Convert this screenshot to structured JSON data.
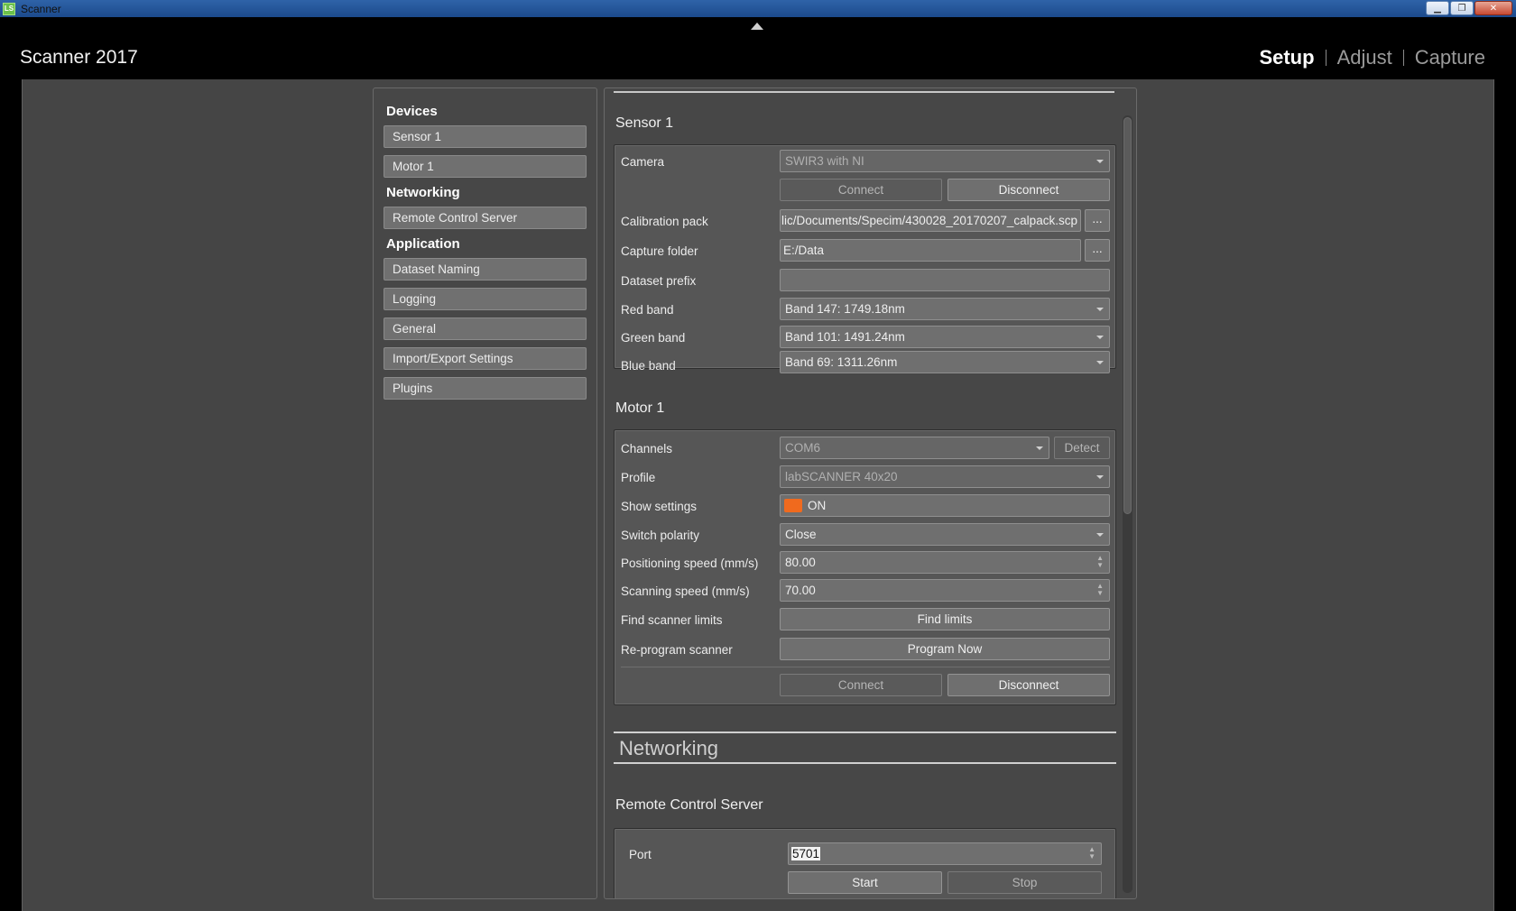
{
  "window": {
    "icon_text": "LS",
    "title": "Scanner",
    "minimize": "▁",
    "maximize": "❐",
    "close": "✕"
  },
  "app": {
    "title": "Scanner 2017"
  },
  "nav": {
    "setup": "Setup",
    "adjust": "Adjust",
    "capture": "Capture"
  },
  "menu": {
    "devices": "Devices",
    "sensor1": "Sensor 1",
    "motor1": "Motor 1",
    "networking": "Networking",
    "remote": "Remote Control Server",
    "application": "Application",
    "dataset_naming": "Dataset Naming",
    "logging": "Logging",
    "general": "General",
    "import_export": "Import/Export Settings",
    "plugins": "Plugins"
  },
  "sensor": {
    "title": "Sensor 1",
    "camera_label": "Camera",
    "camera_value": "SWIR3 with NI",
    "connect": "Connect",
    "disconnect": "Disconnect",
    "calib_label": "Calibration pack",
    "calib_value": "lic/Documents/Specim/430028_20170207_calpack.scp",
    "browse": "...",
    "capture_label": "Capture folder",
    "capture_value": "E:/Data",
    "prefix_label": "Dataset prefix",
    "prefix_value": "",
    "red_label": "Red band",
    "red_value": "Band 147: 1749.18nm",
    "green_label": "Green band",
    "green_value": "Band 101: 1491.24nm",
    "blue_label": "Blue band",
    "blue_value": "Band 69: 1311.26nm"
  },
  "motor": {
    "title": "Motor 1",
    "channels_label": "Channels",
    "channels_value": "COM6",
    "detect": "Detect",
    "profile_label": "Profile",
    "profile_value": "labSCANNER 40x20",
    "show_label": "Show settings",
    "show_value": "ON",
    "polarity_label": "Switch polarity",
    "polarity_value": "Close",
    "pos_speed_label": "Positioning speed (mm/s)",
    "pos_speed_value": "80.00",
    "scan_speed_label": "Scanning speed (mm/s)",
    "scan_speed_value": "70.00",
    "limits_label": "Find scanner limits",
    "limits_btn": "Find limits",
    "reprogram_label": "Re-program scanner",
    "reprogram_btn": "Program Now",
    "connect": "Connect",
    "disconnect": "Disconnect"
  },
  "networking": {
    "header": "Networking",
    "remote_title": "Remote Control Server",
    "port_label": "Port",
    "port_value": "5701",
    "start": "Start",
    "stop": "Stop"
  },
  "colors": {
    "accent": "#f06a1e",
    "background": "#454545",
    "titlebar": "#2f63a8"
  }
}
